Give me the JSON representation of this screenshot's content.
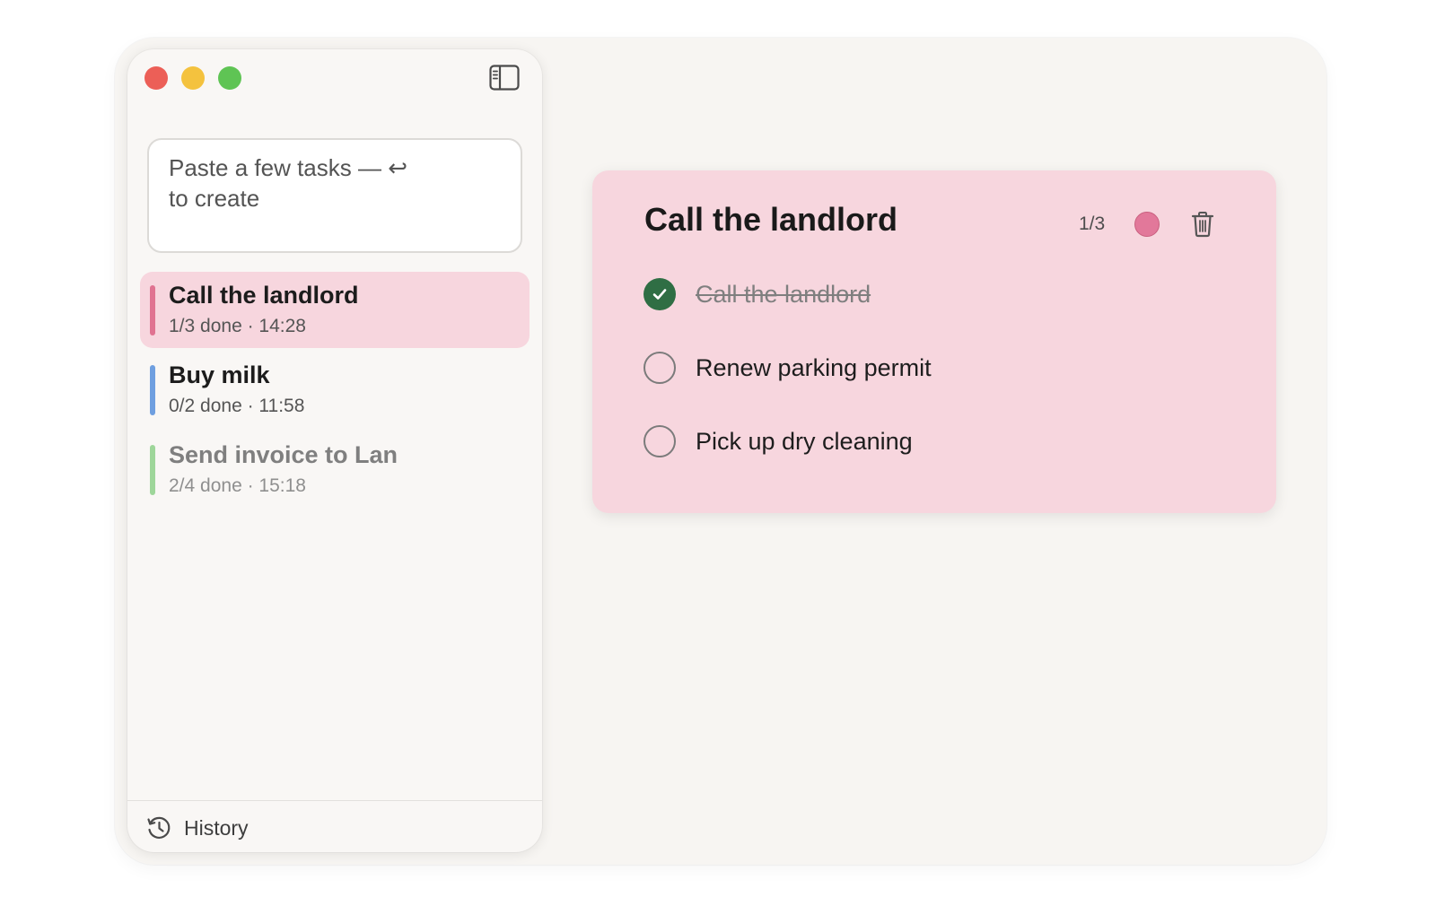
{
  "window": {
    "traffic_lights": [
      "close",
      "minimize",
      "zoom"
    ]
  },
  "sidebar": {
    "toggle_icon": "sidebar-toggle-icon",
    "input": {
      "placeholder": "Paste a few tasks — ↩\nto create"
    },
    "lists": [
      {
        "title": "Call the landlord",
        "subtitle": "1/3 done · 14:28",
        "color": "#e07391",
        "active": true
      },
      {
        "title": "Buy milk",
        "subtitle": "0/2 done · 11:58",
        "color": "#6f9fe0",
        "active": false
      },
      {
        "title": "Send invoice to Lan",
        "subtitle": "2/4 done · 15:18",
        "color": "#9ed69a",
        "active": false
      }
    ],
    "history_label": "History"
  },
  "detail": {
    "title": "Call the landlord",
    "count": "1/3",
    "color": "#e2789a",
    "tasks": [
      {
        "text": "Call the landlord",
        "done": true
      },
      {
        "text": "Renew parking permit",
        "done": false
      },
      {
        "text": "Pick up dry cleaning",
        "done": false
      }
    ]
  }
}
